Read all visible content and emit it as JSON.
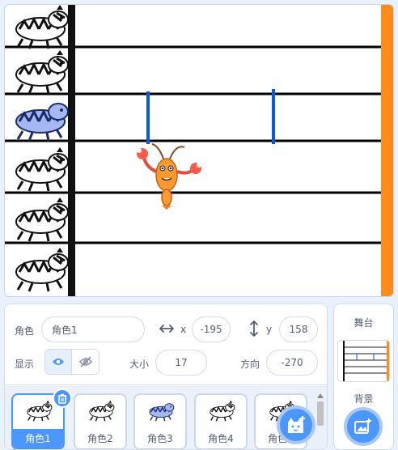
{
  "sprite_info": {
    "sprite_label": "角色",
    "sprite_name": "角色1",
    "x_label": "x",
    "x_value": "-195",
    "y_label": "y",
    "y_value": "158",
    "show_label": "显示",
    "size_label": "大小",
    "size_value": "17",
    "direction_label": "方向",
    "direction_value": "-270"
  },
  "sprites": [
    {
      "name": "角色1",
      "selected": true
    },
    {
      "name": "角色2",
      "selected": false
    },
    {
      "name": "角色3",
      "selected": false
    },
    {
      "name": "角色4",
      "selected": false
    },
    {
      "name": "角色5",
      "selected": false
    }
  ],
  "stage_panel": {
    "title": "舞台",
    "backdrop_label": "背景"
  },
  "colors": {
    "accent": "#4c97ff",
    "stage_bar": "#ff8c1a",
    "stage_line": "#0a57e6",
    "panel_text": "#575e75"
  },
  "icons": {
    "visibility_on": "eye-icon",
    "visibility_off": "eye-slash-icon",
    "delete": "trash-icon",
    "add_sprite": "cat-plus-icon",
    "add_backdrop": "image-plus-icon",
    "x_arrow": "horizontal-arrows-icon",
    "y_arrow": "vertical-arrows-icon"
  }
}
